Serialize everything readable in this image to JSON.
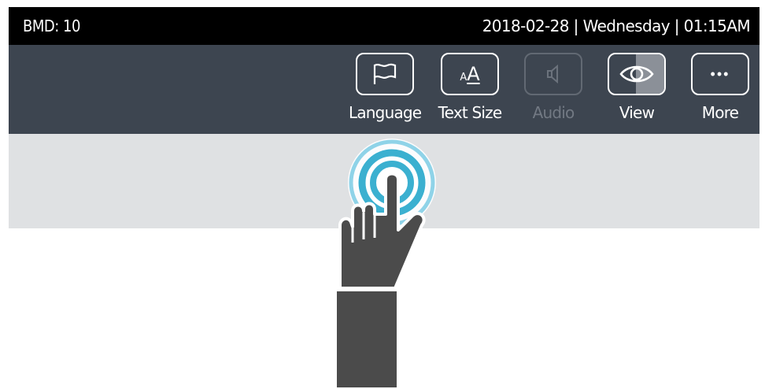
{
  "status_bar": {
    "device": "BMD: 10",
    "datetime": "2018-02-28 | Wednesday | 01:15AM"
  },
  "toolbar": {
    "items": [
      {
        "label": "Language",
        "icon": "flag-icon",
        "enabled": true
      },
      {
        "label": "Text Size",
        "icon": "text-size-icon",
        "enabled": true
      },
      {
        "label": "Audio",
        "icon": "speaker-icon",
        "enabled": false
      },
      {
        "label": "View",
        "icon": "eye-icon",
        "enabled": true
      },
      {
        "label": "More",
        "icon": "more-dots-icon",
        "enabled": true
      }
    ]
  },
  "text_size_glyph": {
    "small": "A",
    "large": "A"
  },
  "more_glyph": "•••",
  "colors": {
    "status_bg": "#000000",
    "toolbar_bg": "#3d4550",
    "content_bg": "#dfe1e3",
    "hand": "#4b4b4b",
    "ripple": "#3bb0d0"
  }
}
